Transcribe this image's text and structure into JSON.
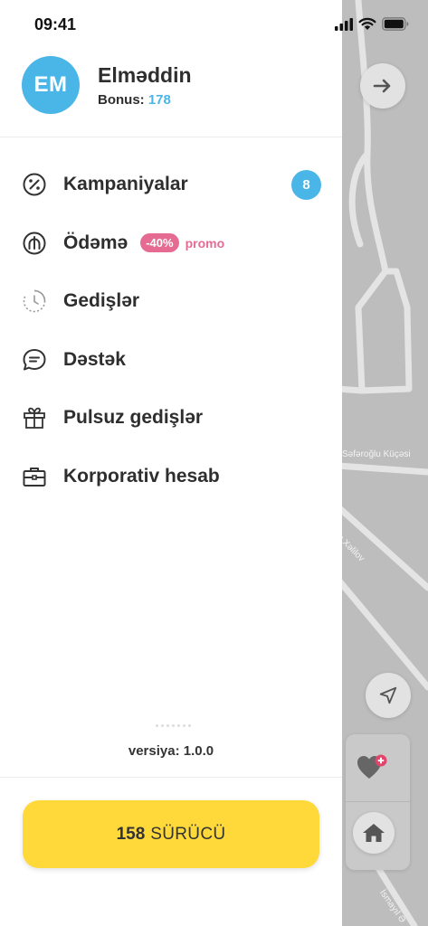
{
  "status_bar": {
    "time": "09:41"
  },
  "profile": {
    "initials": "EM",
    "name": "Elmǝddin",
    "bonus_label": "Bonus:",
    "bonus_value": "178"
  },
  "menu": [
    {
      "label": "Kampaniyalar",
      "icon": "percent-icon",
      "badge": "8"
    },
    {
      "label": "Ödǝmǝ",
      "icon": "manat-icon",
      "promo_pill": "-40%",
      "promo_text": "promo"
    },
    {
      "label": "Gedişlǝr",
      "icon": "history-icon"
    },
    {
      "label": "Dǝstǝk",
      "icon": "chat-support-icon"
    },
    {
      "label": "Pulsuz gedişlǝr",
      "icon": "gift-icon"
    },
    {
      "label": "Korporativ hesab",
      "icon": "briefcase-icon"
    }
  ],
  "version": "versiya: 1.0.0",
  "cta": {
    "count": "158",
    "label": "SÜRÜCÜ"
  },
  "map": {
    "street_labels": [
      "Sǝfǝroğlu Küçǝsi",
      "an Xǝlilov",
      "İsmayıl Ə"
    ]
  },
  "colors": {
    "accent_blue": "#4ab6e8",
    "promo_pink": "#e66b93",
    "cta_yellow": "#ffd83a"
  }
}
